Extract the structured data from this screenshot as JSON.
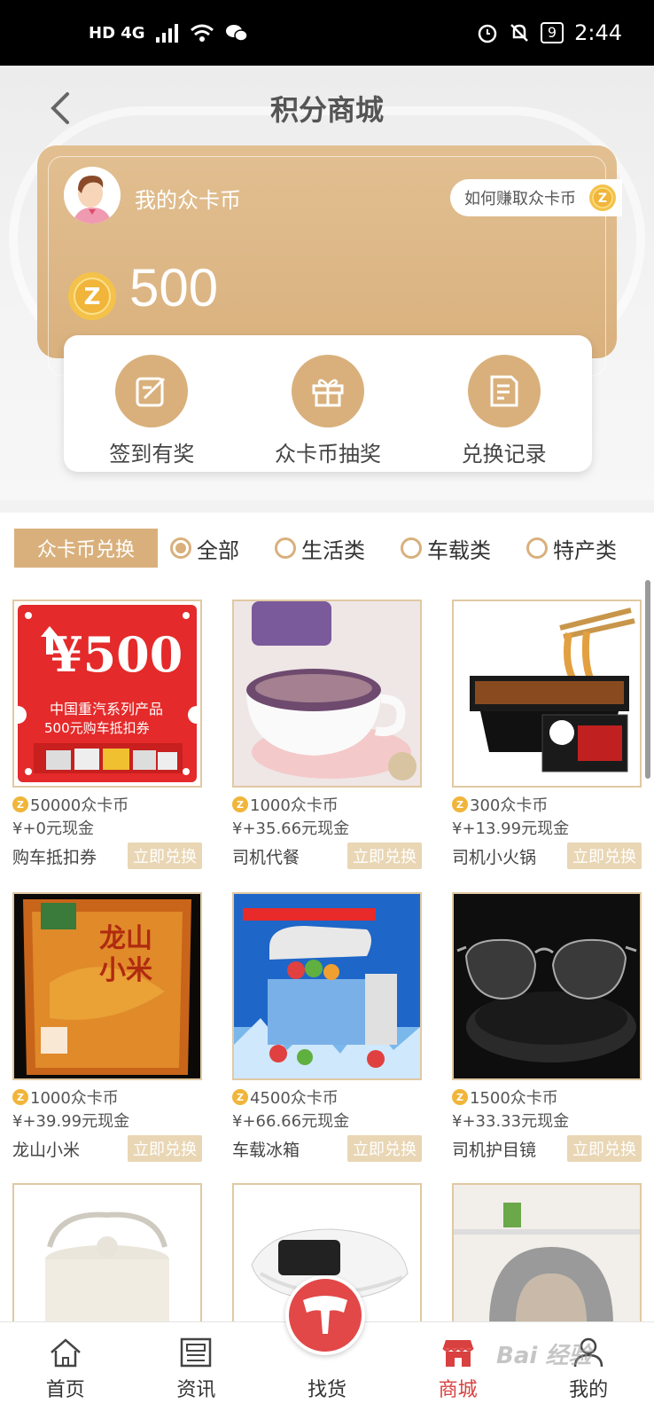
{
  "status_bar": {
    "network": "HD 4G",
    "battery": "9",
    "time": "2:44"
  },
  "nav": {
    "title": "积分商城"
  },
  "coin_card": {
    "my_coin_label": "我的众卡币",
    "earn_link": "如何赚取众卡币",
    "balance": "500"
  },
  "actions": [
    {
      "label": "签到有奖",
      "icon": "checkin-icon"
    },
    {
      "label": "众卡币抽奖",
      "icon": "gift-icon"
    },
    {
      "label": "兑换记录",
      "icon": "record-icon"
    }
  ],
  "filter": {
    "tag": "众卡币兑换",
    "options": [
      "全部",
      "生活类",
      "车载类",
      "特产类"
    ],
    "selected": "全部"
  },
  "products": [
    {
      "coins": "50000众卡币",
      "cash": "¥+0元现金",
      "name": "购车抵扣券",
      "redeem": "立即兑换",
      "voucher": {
        "amount": "¥500",
        "line1": "中国重汽系列产品",
        "line2": "500元购车抵扣券"
      }
    },
    {
      "coins": "1000众卡币",
      "cash": "¥+35.66元现金",
      "name": "司机代餐",
      "redeem": "立即兑换"
    },
    {
      "coins": "300众卡币",
      "cash": "¥+13.99元现金",
      "name": "司机小火锅",
      "redeem": "立即兑换"
    },
    {
      "coins": "1000众卡币",
      "cash": "¥+39.99元现金",
      "name": "龙山小米",
      "redeem": "立即兑换"
    },
    {
      "coins": "4500众卡币",
      "cash": "¥+66.66元现金",
      "name": "车载冰箱",
      "redeem": "立即兑换"
    },
    {
      "coins": "1500众卡币",
      "cash": "¥+33.33元现金",
      "name": "司机护目镜",
      "redeem": "立即兑换"
    }
  ],
  "bottom_nav": [
    {
      "label": "首页",
      "icon": "home-icon"
    },
    {
      "label": "资讯",
      "icon": "news-icon"
    },
    {
      "label": "找货",
      "icon": "truck-logo-icon"
    },
    {
      "label": "商城",
      "icon": "store-icon"
    },
    {
      "label": "我的",
      "icon": "user-icon"
    }
  ],
  "colors": {
    "gold": "#d9b07c",
    "red": "#e24848",
    "coin": "#f0b53a"
  }
}
